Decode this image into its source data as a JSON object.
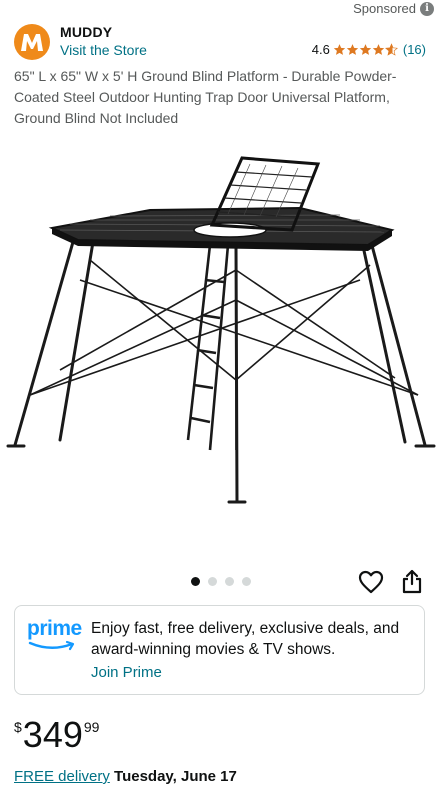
{
  "header": {
    "sponsored_label": "Sponsored",
    "info_icon": "i"
  },
  "brand": {
    "logo_text": "M",
    "name": "MUDDY",
    "visit_store": "Visit the Store",
    "rating": "4.6",
    "rating_value": 4.6,
    "review_count": "(16)"
  },
  "product": {
    "title": "65\" L x 65\" W x 5' H Ground Blind Platform - Durable Powder-Coated Steel Outdoor Hunting Trap Door Universal Platform, Ground Blind Not Included"
  },
  "carousel": {
    "total_images": 4,
    "active_index": 0
  },
  "prime": {
    "logo_text": "prime",
    "message": "Enjoy fast, free delivery, exclusive deals, and award-winning movies & TV shows.",
    "join_label": "Join Prime"
  },
  "price": {
    "symbol": "$",
    "whole": "349",
    "fraction": "99"
  },
  "delivery": {
    "link_label": "FREE delivery",
    "date": "Tuesday, June 17"
  },
  "colors": {
    "link": "#007185",
    "star": "#de7921",
    "brand_logo": "#ef8a1a",
    "prime_blue": "#1399ff"
  }
}
